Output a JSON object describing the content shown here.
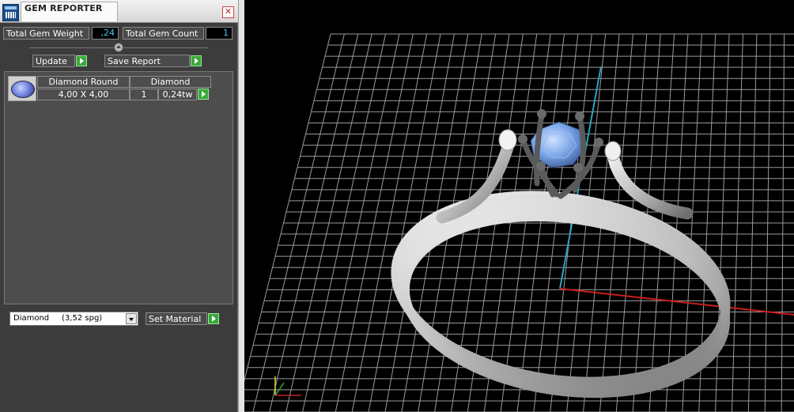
{
  "window": {
    "title": "GEM REPORTER"
  },
  "stats": {
    "weight_label": "Total Gem Weight",
    "weight_value": ",24",
    "count_label": "Total Gem Count",
    "count_value": "1"
  },
  "toolbar": {
    "update_label": "Update",
    "save_label": "Save Report"
  },
  "gem_list": [
    {
      "name": "Diamond Round",
      "type": "Diamond",
      "size": "4,00 X 4,00",
      "count": "1",
      "weight": "0,24tw"
    }
  ],
  "material": {
    "selected": "Diamond     (3,52 spg)",
    "set_label": "Set Material"
  },
  "viewport": {
    "colors": {
      "grid": "#9a9a9a",
      "y_axis": "#2aa6c0",
      "x_axis": "#c81e1e",
      "stone": "#7aa6e8",
      "metal": "#d4d4d4",
      "prongs": "#5a5a5a"
    }
  }
}
